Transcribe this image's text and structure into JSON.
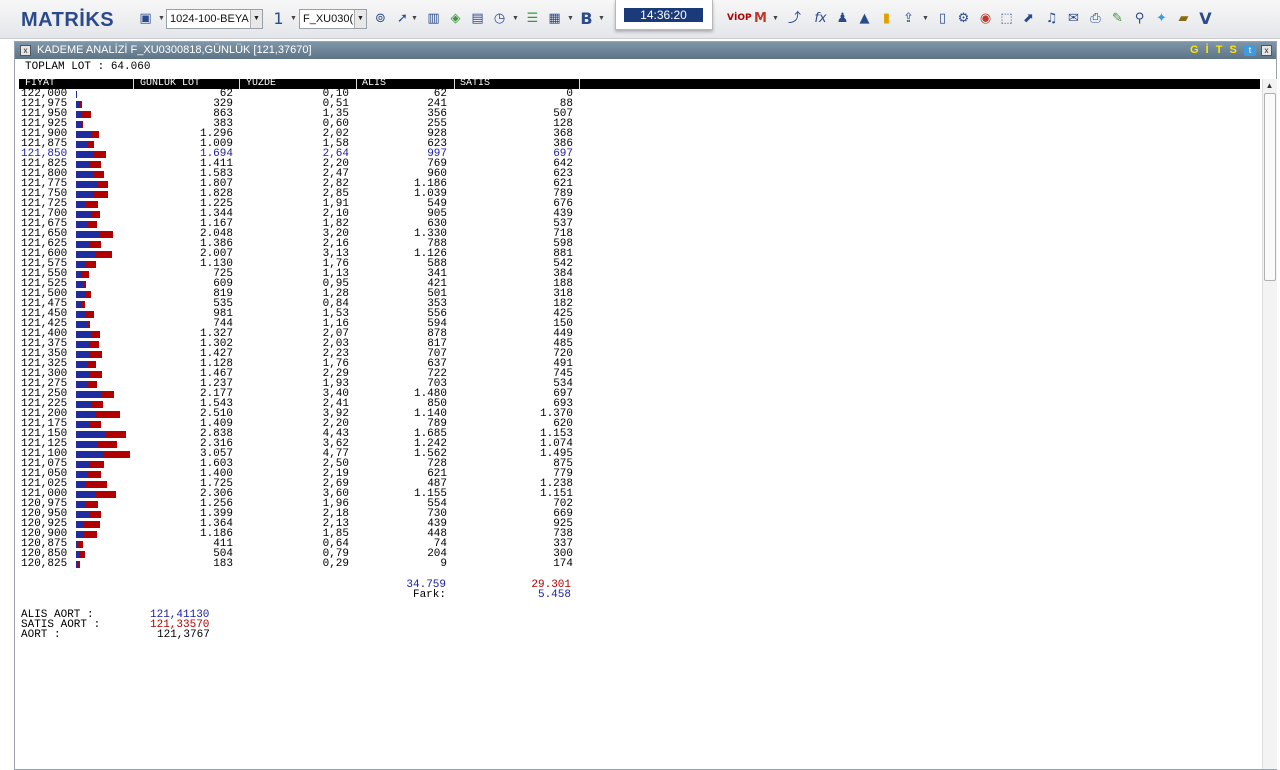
{
  "toolbar": {
    "logo": "MATRİKS",
    "layout_select": "1024-100-BEYA",
    "page_number": "1",
    "symbol_select": "F_XU030(",
    "clock": "14:36:20",
    "bold_label": "B",
    "viop_label": "VİOP",
    "fx_label": "fx",
    "v_label": "V"
  },
  "window": {
    "title": "KADEME ANALİZİ F_XU0300818,GÜNLÜK [121,37670]",
    "gits_label": "G İ T S",
    "twitter_label": "t"
  },
  "summary": {
    "total_label": "TOPLAM LOT : 64.060"
  },
  "table": {
    "headers": [
      "FİYAT",
      "GUNLUK LOT",
      "YUZDE",
      "ALIS",
      "SATIS"
    ],
    "rows": [
      {
        "price": "122,000",
        "lot": "62",
        "pct": "0,10",
        "buy": "62",
        "sell": "0"
      },
      {
        "price": "121,975",
        "lot": "329",
        "pct": "0,51",
        "buy": "241",
        "sell": "88"
      },
      {
        "price": "121,950",
        "lot": "863",
        "pct": "1,35",
        "buy": "356",
        "sell": "507"
      },
      {
        "price": "121,925",
        "lot": "383",
        "pct": "0,60",
        "buy": "255",
        "sell": "128"
      },
      {
        "price": "121,900",
        "lot": "1.296",
        "pct": "2,02",
        "buy": "928",
        "sell": "368"
      },
      {
        "price": "121,875",
        "lot": "1.009",
        "pct": "1,58",
        "buy": "623",
        "sell": "386"
      },
      {
        "price": "121,850",
        "lot": "1.694",
        "pct": "2,64",
        "buy": "997",
        "sell": "697",
        "hl": true
      },
      {
        "price": "121,825",
        "lot": "1.411",
        "pct": "2,20",
        "buy": "769",
        "sell": "642"
      },
      {
        "price": "121,800",
        "lot": "1.583",
        "pct": "2,47",
        "buy": "960",
        "sell": "623"
      },
      {
        "price": "121,775",
        "lot": "1.807",
        "pct": "2,82",
        "buy": "1.186",
        "sell": "621"
      },
      {
        "price": "121,750",
        "lot": "1.828",
        "pct": "2,85",
        "buy": "1.039",
        "sell": "789"
      },
      {
        "price": "121,725",
        "lot": "1.225",
        "pct": "1,91",
        "buy": "549",
        "sell": "676"
      },
      {
        "price": "121,700",
        "lot": "1.344",
        "pct": "2,10",
        "buy": "905",
        "sell": "439"
      },
      {
        "price": "121,675",
        "lot": "1.167",
        "pct": "1,82",
        "buy": "630",
        "sell": "537"
      },
      {
        "price": "121,650",
        "lot": "2.048",
        "pct": "3,20",
        "buy": "1.330",
        "sell": "718"
      },
      {
        "price": "121,625",
        "lot": "1.386",
        "pct": "2,16",
        "buy": "788",
        "sell": "598"
      },
      {
        "price": "121,600",
        "lot": "2.007",
        "pct": "3,13",
        "buy": "1.126",
        "sell": "881"
      },
      {
        "price": "121,575",
        "lot": "1.130",
        "pct": "1,76",
        "buy": "588",
        "sell": "542"
      },
      {
        "price": "121,550",
        "lot": "725",
        "pct": "1,13",
        "buy": "341",
        "sell": "384"
      },
      {
        "price": "121,525",
        "lot": "609",
        "pct": "0,95",
        "buy": "421",
        "sell": "188"
      },
      {
        "price": "121,500",
        "lot": "819",
        "pct": "1,28",
        "buy": "501",
        "sell": "318"
      },
      {
        "price": "121,475",
        "lot": "535",
        "pct": "0,84",
        "buy": "353",
        "sell": "182"
      },
      {
        "price": "121,450",
        "lot": "981",
        "pct": "1,53",
        "buy": "556",
        "sell": "425"
      },
      {
        "price": "121,425",
        "lot": "744",
        "pct": "1,16",
        "buy": "594",
        "sell": "150"
      },
      {
        "price": "121,400",
        "lot": "1.327",
        "pct": "2,07",
        "buy": "878",
        "sell": "449"
      },
      {
        "price": "121,375",
        "lot": "1.302",
        "pct": "2,03",
        "buy": "817",
        "sell": "485"
      },
      {
        "price": "121,350",
        "lot": "1.427",
        "pct": "2,23",
        "buy": "707",
        "sell": "720"
      },
      {
        "price": "121,325",
        "lot": "1.128",
        "pct": "1,76",
        "buy": "637",
        "sell": "491"
      },
      {
        "price": "121,300",
        "lot": "1.467",
        "pct": "2,29",
        "buy": "722",
        "sell": "745"
      },
      {
        "price": "121,275",
        "lot": "1.237",
        "pct": "1,93",
        "buy": "703",
        "sell": "534"
      },
      {
        "price": "121,250",
        "lot": "2.177",
        "pct": "3,40",
        "buy": "1.480",
        "sell": "697"
      },
      {
        "price": "121,225",
        "lot": "1.543",
        "pct": "2,41",
        "buy": "850",
        "sell": "693"
      },
      {
        "price": "121,200",
        "lot": "2.510",
        "pct": "3,92",
        "buy": "1.140",
        "sell": "1.370"
      },
      {
        "price": "121,175",
        "lot": "1.409",
        "pct": "2,20",
        "buy": "789",
        "sell": "620"
      },
      {
        "price": "121,150",
        "lot": "2.838",
        "pct": "4,43",
        "buy": "1.685",
        "sell": "1.153"
      },
      {
        "price": "121,125",
        "lot": "2.316",
        "pct": "3,62",
        "buy": "1.242",
        "sell": "1.074"
      },
      {
        "price": "121,100",
        "lot": "3.057",
        "pct": "4,77",
        "buy": "1.562",
        "sell": "1.495"
      },
      {
        "price": "121,075",
        "lot": "1.603",
        "pct": "2,50",
        "buy": "728",
        "sell": "875"
      },
      {
        "price": "121,050",
        "lot": "1.400",
        "pct": "2,19",
        "buy": "621",
        "sell": "779"
      },
      {
        "price": "121,025",
        "lot": "1.725",
        "pct": "2,69",
        "buy": "487",
        "sell": "1.238"
      },
      {
        "price": "121,000",
        "lot": "2.306",
        "pct": "3,60",
        "buy": "1.155",
        "sell": "1.151"
      },
      {
        "price": "120,975",
        "lot": "1.256",
        "pct": "1,96",
        "buy": "554",
        "sell": "702"
      },
      {
        "price": "120,950",
        "lot": "1.399",
        "pct": "2,18",
        "buy": "730",
        "sell": "669"
      },
      {
        "price": "120,925",
        "lot": "1.364",
        "pct": "2,13",
        "buy": "439",
        "sell": "925"
      },
      {
        "price": "120,900",
        "lot": "1.186",
        "pct": "1,85",
        "buy": "448",
        "sell": "738"
      },
      {
        "price": "120,875",
        "lot": "411",
        "pct": "0,64",
        "buy": "74",
        "sell": "337"
      },
      {
        "price": "120,850",
        "lot": "504",
        "pct": "0,79",
        "buy": "204",
        "sell": "300"
      },
      {
        "price": "120,825",
        "lot": "183",
        "pct": "0,29",
        "buy": "9",
        "sell": "174"
      }
    ]
  },
  "totals": {
    "buy_total": "34.759",
    "sell_total": "29.301",
    "fark_label": "Fark:",
    "fark_value": "5.458"
  },
  "averages": {
    "buy_label": "ALIS AORT :",
    "buy_value": "121,41130",
    "sell_label": "SATIS AORT :",
    "sell_value": "121,33570",
    "avg_label": "AORT :",
    "avg_value": "121,3767"
  },
  "colors": {
    "buy": "#1e2ca0",
    "sell": "#b00000",
    "title_bg": "#6b8396",
    "header_bg": "#000000",
    "logo": "#2a4a8c"
  }
}
